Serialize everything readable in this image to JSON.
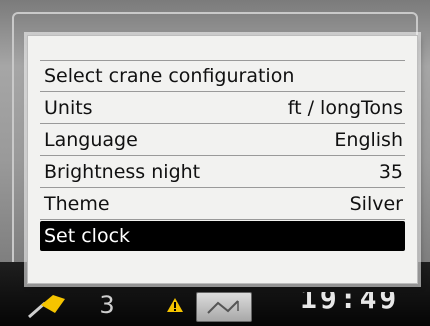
{
  "menu": {
    "items": [
      {
        "label": "Select crane configuration",
        "value": ""
      },
      {
        "label": "Units",
        "value": "ft / longTons"
      },
      {
        "label": "Language",
        "value": "English"
      },
      {
        "label": "Brightness night",
        "value": "35"
      },
      {
        "label": "Theme",
        "value": "Silver"
      },
      {
        "label": "Set clock",
        "value": ""
      }
    ],
    "selected_index": 5
  },
  "status_bar": {
    "counter": "3",
    "clock": "19:49",
    "icons": [
      "tag-icon",
      "warning-icon",
      "crane-icon"
    ]
  },
  "colors": {
    "dialog_bg": "#f2f2f0",
    "selected_bg": "#000000",
    "warning": "#f5c400"
  }
}
